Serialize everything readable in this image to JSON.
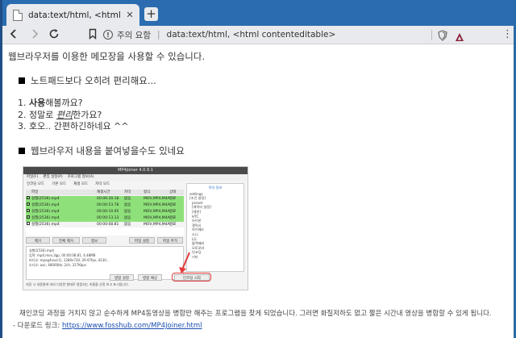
{
  "browser": {
    "tab_title": "data:text/html, <html contenteditable>",
    "tab_close": "✕",
    "new_tab": "+",
    "security_warning": "주의 요함",
    "address_url": "data:text/html, <html contenteditable>",
    "address_separator": "|"
  },
  "page": {
    "intro": "웹브라우저를 이용한 메모장을 사용할 수 있습니다.",
    "heading1": "노트패드보다 오히려 편리해요...",
    "list": {
      "item1_num": "1.",
      "item1_bold": "사용",
      "item1_rest": "해볼까요?",
      "item2_num": "2.",
      "item2_pre": "정말로 ",
      "item2_em": "편리",
      "item2_rest": "한가요?",
      "item3": "3. 호오.. 간편하긴하네요 ^^"
    },
    "heading2": "웹브라우저 내용을 붙여넣을수도 있네요",
    "description": "재인코딩 과정을 거치지 않고 순수하게 MP4동영상을 병합만 해주는 프로그램을 찾게 되었습니다.   그러면 화질저하도 없고 짧은 시간내 영상을 병합할 수 있게 됩니다.",
    "download_prefix": "-  다운로드 링크: ",
    "download_link": "https://www.fosshub.com/MP4Joiner.html"
  },
  "embedded": {
    "title": "MP4Joiner 4.0.9.1",
    "menu": [
      "파일(F)",
      "편집 설정(P)",
      "프로그램 정보(A)"
    ],
    "toolbar": [
      "인코딩 모드",
      "기본 모드",
      "재생 모드",
      "자막 모드"
    ],
    "columns": [
      "파일",
      "재생시간",
      "자막",
      "형식",
      "상태"
    ],
    "rows": [
      {
        "file": "실행(2536).mp4",
        "time": "00:00:30.18",
        "sub": "없음",
        "format": "MOV,MP4,M4A...",
        "status": "완료"
      },
      {
        "file": "실행(2536).mp4",
        "time": "00:00:53.78",
        "sub": "없음",
        "format": "MOV,MP4,M4A...",
        "status": "완료"
      },
      {
        "file": "실행(2536).mp4",
        "time": "00:00:10.95",
        "sub": "없음",
        "format": "MOV,MP4,M4A...",
        "status": "완료"
      },
      {
        "file": "실행(2536).mp4",
        "time": "00:00:13.13",
        "sub": "없음",
        "format": "MOV,MP4,M4A...",
        "status": "완료"
      },
      {
        "file": "실행(2536).mp4",
        "time": "00:00:08.81",
        "sub": "없음",
        "format": "MOV,MP4,M4A...",
        "status": "완료"
      }
    ],
    "buttons": [
      "제거",
      "전체 제거",
      "정보",
      "파일 설정",
      "파일 추가"
    ],
    "info_lines": [
      "실행(2536).mp4",
      "입력: mp4,mov,3gp, 00:00:08.81, 4,48MB",
      "비디오: mpeg4(avc1), 1280x720, 29.97fps, 4230...",
      "오디오: aac, 48000Hz, 2ch, 317Kbps"
    ],
    "bottom_buttons": [
      "병합 설정",
      "병합 예상",
      "인코딩 시작"
    ],
    "status": "저장 시 내용물에 따라 다양한 형태로 병합되는 비율을 산정 보고 표시됩니다.",
    "side_header": "목차 정보",
    "side_items": [
      "settings",
      "[조건 설정]",
      "preset",
      "[캐릭터 설정]",
      "[제한]",
      "HTC",
      "아이폰",
      "갤럭시",
      "아이패드",
      "소니",
      "LG",
      "블랙베리",
      "모토로라",
      "인코딩",
      "기타"
    ]
  },
  "colors": {
    "tabstrip": "#2b6cb0",
    "toolbar": "#e8eaed",
    "green_row": "#8ee17a",
    "annotation_red": "#e23b3b",
    "link": "#1a4fb0"
  }
}
